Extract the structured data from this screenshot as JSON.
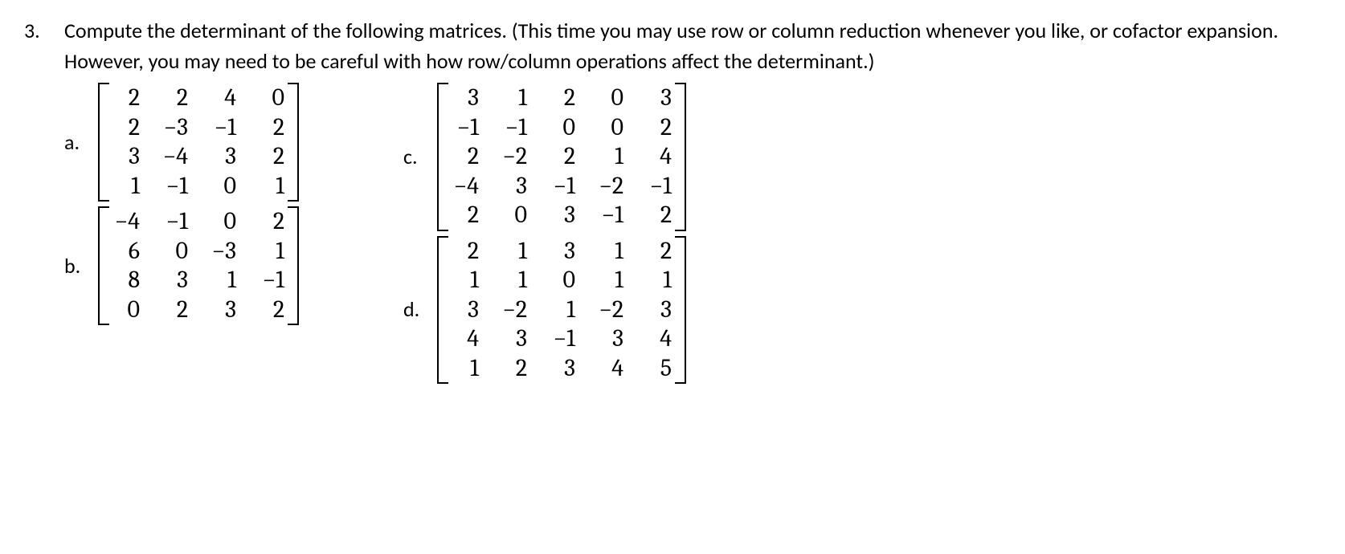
{
  "problem_number": "3.",
  "prompt": "Compute the determinant of the following matrices. (This time you may use row or column reduction whenever you like, or cofactor expansion. However, you may need to be careful with how row/column operations affect the determinant.)",
  "items": {
    "a": {
      "label": "a.",
      "matrix": [
        [
          "2",
          "2",
          "4",
          "0"
        ],
        [
          "2",
          "−3",
          "−1",
          "2"
        ],
        [
          "3",
          "−4",
          "3",
          "2"
        ],
        [
          "1",
          "−1",
          "0",
          "1"
        ]
      ]
    },
    "b": {
      "label": "b.",
      "matrix": [
        [
          "−4",
          "−1",
          "0",
          "2"
        ],
        [
          "6",
          "0",
          "−3",
          "1"
        ],
        [
          "8",
          "3",
          "1",
          "−1"
        ],
        [
          "0",
          "2",
          "3",
          "2"
        ]
      ]
    },
    "c": {
      "label": "c.",
      "matrix": [
        [
          "3",
          "1",
          "2",
          "0",
          "3"
        ],
        [
          "−1",
          "−1",
          "0",
          "0",
          "2"
        ],
        [
          "2",
          "−2",
          "2",
          "1",
          "4"
        ],
        [
          "−4",
          "3",
          "−1",
          "−2",
          "−1"
        ],
        [
          "2",
          "0",
          "3",
          "−1",
          "2"
        ]
      ]
    },
    "d": {
      "label": "d.",
      "matrix": [
        [
          "2",
          "1",
          "3",
          "1",
          "2"
        ],
        [
          "1",
          "1",
          "0",
          "1",
          "1"
        ],
        [
          "3",
          "−2",
          "1",
          "−2",
          "3"
        ],
        [
          "4",
          "3",
          "−1",
          "3",
          "4"
        ],
        [
          "1",
          "2",
          "3",
          "4",
          "5"
        ]
      ]
    }
  }
}
